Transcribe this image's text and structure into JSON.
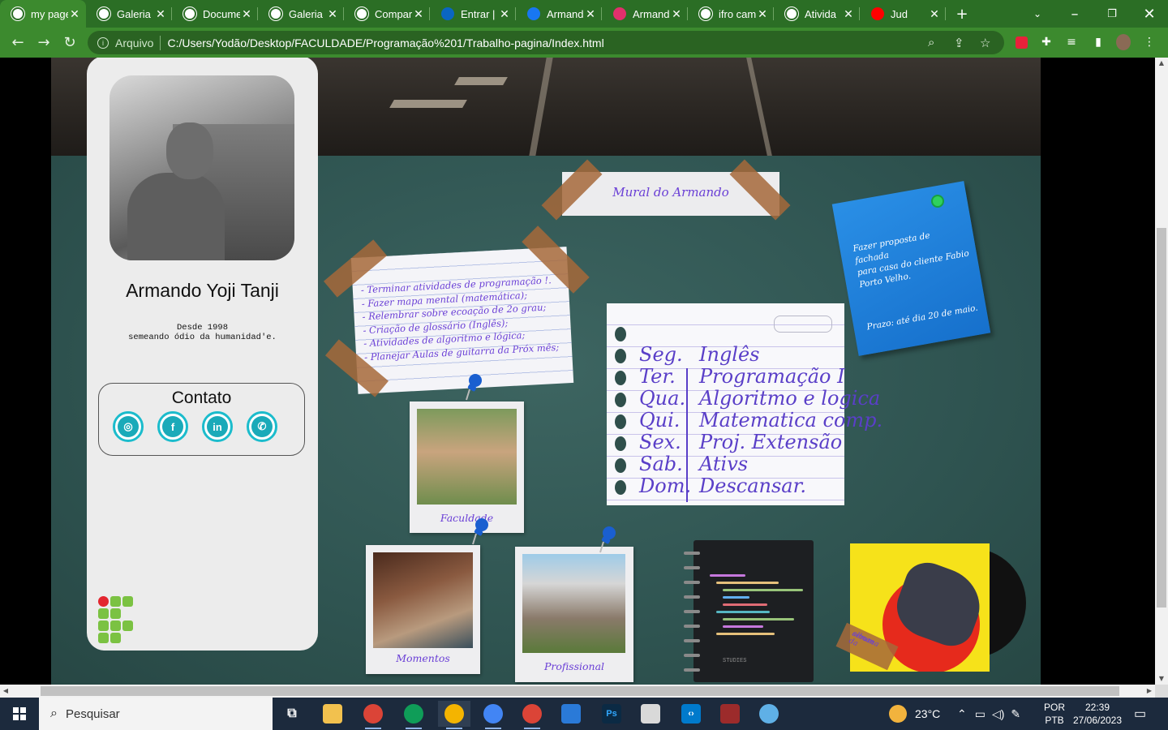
{
  "browser": {
    "tabs": [
      {
        "label": "my page",
        "icon": "globe-icon",
        "active": true
      },
      {
        "label": "Galeria",
        "icon": "globe-icon"
      },
      {
        "label": "Docume",
        "icon": "globe-icon"
      },
      {
        "label": "Galeria",
        "icon": "globe-icon"
      },
      {
        "label": "Compar",
        "icon": "globe-icon"
      },
      {
        "label": "Entrar |",
        "icon": "linkedin-icon"
      },
      {
        "label": "Armand",
        "icon": "facebook-icon"
      },
      {
        "label": "Armand",
        "icon": "instagram-icon"
      },
      {
        "label": "ifro cam",
        "icon": "google-icon"
      },
      {
        "label": "Ativida",
        "icon": "globe-icon"
      },
      {
        "label": "Jud",
        "icon": "youtube-icon"
      }
    ],
    "address": {
      "security_label": "Arquivo",
      "url": "C:/Users/Yodão/Desktop/FACULDADE/Programação%201/Trabalho-pagina/Index.html"
    }
  },
  "profile": {
    "name": "Armando Yoji Tanji",
    "bio_line1": "Desde 1998",
    "bio_line2": "semeando ódio da humanidad'e.",
    "contact_title": "Contato",
    "social": [
      {
        "name": "instagram-icon",
        "glyph": "◎"
      },
      {
        "name": "facebook-icon",
        "glyph": "f"
      },
      {
        "name": "linkedin-icon",
        "glyph": "in"
      },
      {
        "name": "whatsapp-icon",
        "glyph": "✆"
      }
    ]
  },
  "board": {
    "title": "Mural do Armando",
    "todo": [
      "- Terminar atividades de programação !.",
      "- Fazer mapa mental (matemática);",
      "- Relembrar sobre ecoação de 2o grau;",
      "- Criação de glossário (Inglês);",
      "- Atividades de algoritmo e lógica;",
      "- Planejar Aulas de guitarra da Próx mês;"
    ],
    "sticky_lines": [
      "Fazer proposta de fachada",
      "para casa do cliente Fabio",
      "Porto Velho."
    ],
    "sticky_deadline": "Prazo: até dia 20 de maio.",
    "schedule": [
      {
        "day": "Seg.",
        "task": "Inglês"
      },
      {
        "day": "Ter.",
        "task": "Programação I"
      },
      {
        "day": "Qua.",
        "task": "Algoritmo e logica"
      },
      {
        "day": "Qui.",
        "task": "Matematica comp."
      },
      {
        "day": "Sex.",
        "task": "Proj. Extensão"
      },
      {
        "day": "Sab.",
        "task": "Ativs"
      },
      {
        "day": "Dom.",
        "task": "Descansar."
      }
    ],
    "photos": {
      "faculdade": "Faculdade",
      "momentos": "Momentos",
      "profissional": "Profissional"
    },
    "notebook_label": "STUDIES",
    "album_label_line1": "album da",
    "album_label_line2": "semana"
  },
  "taskbar": {
    "search_placeholder": "Pesquisar",
    "weather": "23°C",
    "lang1": "POR",
    "lang2": "PTB",
    "time": "22:39",
    "date": "27/06/2023"
  },
  "colors": {
    "chrome_green": "#3c8a2e",
    "board_green": "#2f5451",
    "ink_purple": "#6a3fd6",
    "tape_brown": "#a6683a",
    "sticky_blue": "#1670cc"
  }
}
